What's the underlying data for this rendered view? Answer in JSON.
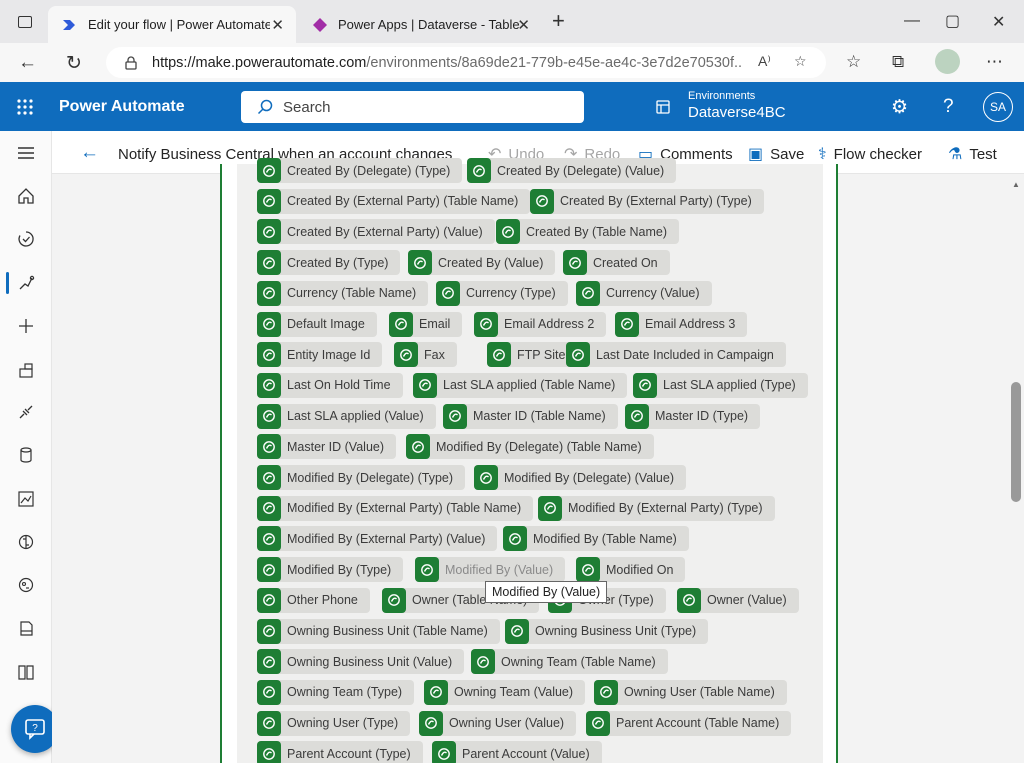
{
  "browser": {
    "tabs": [
      {
        "title": "Edit your flow | Power Automate",
        "active": true
      },
      {
        "title": "Power Apps | Dataverse - Tables",
        "active": false
      }
    ],
    "url_host": "https://make.powerautomate.com",
    "url_path": "/environments/8a69de21-779b-e45e-ae4c-3e7d2e70530f..."
  },
  "header": {
    "brand": "Power Automate",
    "search_placeholder": "Search",
    "environment_label": "Environments",
    "environment_name": "Dataverse4BC",
    "user_initials": "SA",
    "color": "#0f6cbd"
  },
  "commandbar": {
    "flow_title": "Notify Business Central when an account changes",
    "undo": "Undo",
    "redo": "Redo",
    "comments": "Comments",
    "save": "Save",
    "flow_checker": "Flow checker",
    "test": "Test"
  },
  "chips": [
    "Created By (Delegate) (Type)",
    "Created By (Delegate) (Value)",
    "Created By (External Party) (Table Name)",
    "Created By (External Party) (Type)",
    "Created By (External Party) (Value)",
    "Created By (Table Name)",
    "Created By (Type)",
    "Created By (Value)",
    "Created On",
    "Currency (Table Name)",
    "Currency (Type)",
    "Currency (Value)",
    "Default Image",
    "Email",
    "Email Address 2",
    "Email Address 3",
    "Entity Image Id",
    "Fax",
    "FTP Site",
    "Last Date Included in Campaign",
    "Last On Hold Time",
    "Last SLA applied (Table Name)",
    "Last SLA applied (Type)",
    "Last SLA applied (Value)",
    "Master ID (Table Name)",
    "Master ID (Type)",
    "Master ID (Value)",
    "Modified By (Delegate) (Table Name)",
    "Modified By (Delegate) (Type)",
    "Modified By (Delegate) (Value)",
    "Modified By (External Party) (Table Name)",
    "Modified By (External Party) (Type)",
    "Modified By (External Party) (Value)",
    "Modified By (Table Name)",
    "Modified By (Type)",
    "Modified By (Value)",
    "Modified On",
    "Other Phone",
    "Owner (Table Name)",
    "Owner (Type)",
    "Owner (Value)",
    "Owning Business Unit (Table Name)",
    "Owning Business Unit (Type)",
    "Owning Business Unit (Value)",
    "Owning Team (Table Name)",
    "Owning Team (Type)",
    "Owning Team (Value)",
    "Owning User (Table Name)",
    "Owning User (Type)",
    "Owning User (Value)",
    "Parent Account (Table Name)",
    "Parent Account (Type)",
    "Parent Account (Value)"
  ],
  "tooltip": "Modified By (Value)",
  "chip_icon_color": "#1e7e34"
}
